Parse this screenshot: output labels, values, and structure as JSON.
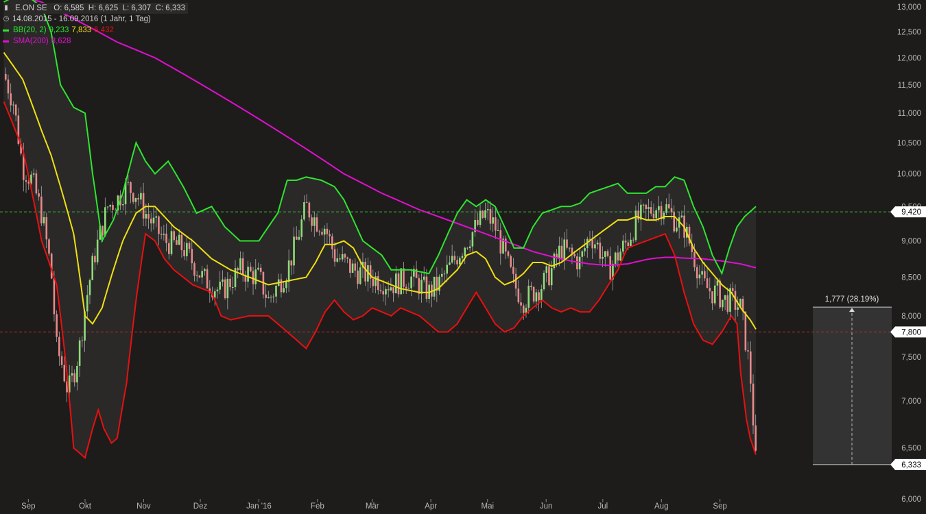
{
  "header": {
    "symbol": "E.ON SE",
    "ohlc": "O: 6,585  H: 6,625  L: 6,307  C: 6,333",
    "period": "14.08.2015 - 16.09.2016 (1 Jahr, 1 Tag)",
    "bb_label": "BB(20, 2)",
    "bb_upper": "9,233",
    "bb_mid": "7,833",
    "bb_lower": "6,432",
    "sma_label": "SMA(200)",
    "sma_value": "8,628"
  },
  "colors": {
    "background": "#1e1c1b",
    "bb_upper": "#2ee52e",
    "bb_mid": "#f0e010",
    "bb_lower": "#e81010",
    "sma": "#e010d0",
    "candle_up": "#8edc7a",
    "candle_down": "#e88a8a",
    "grid_green": "#33c033",
    "grid_red": "#c03030"
  },
  "chart_data": {
    "type": "line",
    "title": "",
    "yscale": "log",
    "ylim": [
      6.0,
      13.0
    ],
    "y_ticks": [
      "13,000",
      "12,500",
      "12,000",
      "11,500",
      "11,000",
      "10,500",
      "10,000",
      "9,500",
      "9,000",
      "8,500",
      "8,000",
      "7,500",
      "7,000",
      "6,500",
      "6,000"
    ],
    "x_labels": [
      "Sep",
      "Okt",
      "Nov",
      "Dez",
      "Jan '16",
      "Feb",
      "Mär",
      "Apr",
      "Mai",
      "Jun",
      "Jul",
      "Aug",
      "Sep"
    ],
    "x_label_days": [
      13,
      43,
      74,
      104,
      135,
      166,
      195,
      226,
      256,
      287,
      317,
      348,
      379
    ],
    "last_price_label": "6,333",
    "last_price": 6.333,
    "hline_green": {
      "value": 9.42,
      "label": "9,420"
    },
    "hline_red": {
      "value": 7.8,
      "label": "7,800"
    },
    "measure": {
      "label": "1,777 (28.19%)",
      "from": 6.333,
      "to": 8.11
    },
    "series": [
      {
        "name": "Kurs",
        "days": [
          0,
          5,
          10,
          15,
          20,
          25,
          28,
          31,
          34,
          37,
          40,
          43,
          45,
          48,
          55,
          60,
          65,
          70,
          75,
          85,
          95,
          105,
          115,
          125,
          135,
          140,
          145,
          150,
          155,
          160,
          165,
          170,
          175,
          185,
          195,
          205,
          215,
          225,
          230,
          235,
          240,
          245,
          250,
          255,
          260,
          265,
          270,
          275,
          280,
          285,
          290,
          295,
          300,
          305,
          310,
          315,
          320,
          325,
          330,
          335,
          340,
          345,
          350,
          355,
          360,
          365,
          370,
          375,
          378,
          380,
          385,
          390,
          395,
          398
        ],
        "values": [
          11.7,
          11.2,
          10.1,
          9.9,
          9.4,
          8.6,
          7.6,
          7.4,
          7.1,
          7.3,
          7.6,
          8.1,
          8.4,
          8.8,
          9.5,
          9.6,
          9.8,
          9.7,
          9.4,
          9.0,
          8.9,
          8.5,
          8.3,
          8.6,
          8.5,
          8.2,
          8.4,
          8.6,
          9.0,
          9.5,
          9.3,
          9.2,
          8.8,
          8.6,
          8.5,
          8.4,
          8.5,
          8.3,
          8.4,
          8.6,
          8.8,
          9.0,
          9.2,
          9.4,
          9.2,
          8.8,
          8.4,
          8.2,
          8.3,
          8.4,
          8.6,
          8.9,
          8.8,
          8.7,
          9.1,
          8.9,
          8.6,
          8.8,
          9.0,
          9.3,
          9.4,
          9.5,
          9.5,
          9.3,
          9.2,
          8.8,
          8.4,
          8.3,
          8.3,
          8.2,
          8.2,
          8.1,
          7.3,
          6.333
        ]
      },
      {
        "name": "BB(20, 2) oben",
        "days": [
          0,
          10,
          20,
          25,
          30,
          37,
          43,
          47,
          52,
          58,
          63,
          70,
          75,
          80,
          87,
          95,
          102,
          110,
          117,
          125,
          135,
          145,
          150,
          155,
          160,
          168,
          175,
          180,
          185,
          190,
          195,
          200,
          205,
          215,
          225,
          230,
          240,
          245,
          250,
          255,
          260,
          265,
          270,
          275,
          280,
          285,
          290,
          295,
          300,
          305,
          310,
          315,
          320,
          325,
          330,
          340,
          345,
          350,
          355,
          360,
          365,
          370,
          375,
          380,
          384,
          388,
          392,
          398
        ],
        "values": [
          13.1,
          13.3,
          13.0,
          12.5,
          11.5,
          11.1,
          11.0,
          10.0,
          9.0,
          9.3,
          9.7,
          10.5,
          10.2,
          10.0,
          10.2,
          9.8,
          9.4,
          9.5,
          9.2,
          9.0,
          9.0,
          9.4,
          9.9,
          9.9,
          9.95,
          9.9,
          9.8,
          9.6,
          9.3,
          9.0,
          8.9,
          8.8,
          8.6,
          8.6,
          8.55,
          8.8,
          9.4,
          9.6,
          9.5,
          9.6,
          9.5,
          9.2,
          8.9,
          8.9,
          9.2,
          9.4,
          9.45,
          9.5,
          9.5,
          9.55,
          9.7,
          9.75,
          9.8,
          9.85,
          9.7,
          9.7,
          9.8,
          9.8,
          9.95,
          9.9,
          9.5,
          9.2,
          8.8,
          8.55,
          8.9,
          9.2,
          9.35,
          9.5
        ]
      },
      {
        "name": "BB(20, 2) Mitte",
        "days": [
          0,
          10,
          20,
          25,
          30,
          37,
          43,
          47,
          52,
          58,
          63,
          70,
          75,
          80,
          90,
          100,
          110,
          120,
          130,
          140,
          150,
          160,
          165,
          170,
          175,
          180,
          185,
          190,
          195,
          200,
          205,
          210,
          220,
          225,
          230,
          240,
          245,
          250,
          255,
          260,
          265,
          270,
          275,
          280,
          285,
          290,
          295,
          300,
          305,
          310,
          315,
          320,
          325,
          330,
          335,
          340,
          345,
          350,
          355,
          360,
          365,
          370,
          375,
          380,
          385,
          390,
          395,
          398
        ],
        "values": [
          12.1,
          11.6,
          10.7,
          10.3,
          9.8,
          9.1,
          8.0,
          7.9,
          8.1,
          8.6,
          9.0,
          9.4,
          9.5,
          9.5,
          9.2,
          9.0,
          8.75,
          8.6,
          8.5,
          8.4,
          8.45,
          8.5,
          8.7,
          8.95,
          8.95,
          9.0,
          8.9,
          8.65,
          8.5,
          8.45,
          8.4,
          8.35,
          8.3,
          8.3,
          8.35,
          8.6,
          8.8,
          8.85,
          8.75,
          8.5,
          8.4,
          8.45,
          8.55,
          8.7,
          8.7,
          8.65,
          8.7,
          8.8,
          8.9,
          9.0,
          9.1,
          9.2,
          9.3,
          9.3,
          9.35,
          9.3,
          9.3,
          9.35,
          9.35,
          9.2,
          8.9,
          8.7,
          8.55,
          8.4,
          8.3,
          8.1,
          7.95,
          7.833
        ]
      },
      {
        "name": "BB(20, 2) unten",
        "days": [
          0,
          10,
          20,
          28,
          33,
          37,
          43,
          47,
          50,
          53,
          57,
          60,
          65,
          70,
          75,
          80,
          85,
          90,
          100,
          110,
          115,
          120,
          130,
          140,
          150,
          160,
          165,
          170,
          175,
          180,
          185,
          190,
          195,
          200,
          205,
          210,
          215,
          220,
          225,
          230,
          235,
          240,
          245,
          250,
          255,
          260,
          265,
          270,
          275,
          280,
          285,
          290,
          295,
          300,
          305,
          310,
          315,
          320,
          325,
          330,
          335,
          340,
          345,
          350,
          355,
          360,
          365,
          370,
          375,
          380,
          385,
          388,
          390,
          393,
          395,
          398
        ],
        "values": [
          11.2,
          10.4,
          9.0,
          8.4,
          7.4,
          6.5,
          6.4,
          6.7,
          6.9,
          6.7,
          6.55,
          6.6,
          7.2,
          8.2,
          9.1,
          9.0,
          8.75,
          8.6,
          8.4,
          8.3,
          8.0,
          7.95,
          8.0,
          8.0,
          7.8,
          7.6,
          7.8,
          8.05,
          8.2,
          8.05,
          7.95,
          8.0,
          8.1,
          8.05,
          8.0,
          8.1,
          8.05,
          8.0,
          7.9,
          7.8,
          7.8,
          7.9,
          8.1,
          8.3,
          8.1,
          7.9,
          7.8,
          7.85,
          8.0,
          8.1,
          8.2,
          8.1,
          8.05,
          8.1,
          8.05,
          8.05,
          8.2,
          8.4,
          8.6,
          8.9,
          8.95,
          9.0,
          9.05,
          9.1,
          8.8,
          8.3,
          7.9,
          7.7,
          7.65,
          7.8,
          8.0,
          7.9,
          7.3,
          6.8,
          6.6,
          6.432
        ]
      },
      {
        "name": "SMA(200)",
        "days": [
          0,
          20,
          40,
          60,
          80,
          100,
          120,
          140,
          160,
          180,
          200,
          220,
          240,
          260,
          270,
          280,
          290,
          300,
          310,
          320,
          330,
          340,
          345,
          350,
          355,
          360,
          370,
          380,
          390,
          398
        ],
        "values": [
          13.3,
          13.1,
          12.7,
          12.3,
          12.0,
          11.6,
          11.2,
          10.8,
          10.4,
          10.0,
          9.7,
          9.45,
          9.25,
          9.05,
          8.95,
          8.85,
          8.78,
          8.72,
          8.68,
          8.66,
          8.68,
          8.74,
          8.76,
          8.77,
          8.77,
          8.76,
          8.75,
          8.72,
          8.68,
          8.628
        ]
      }
    ]
  }
}
